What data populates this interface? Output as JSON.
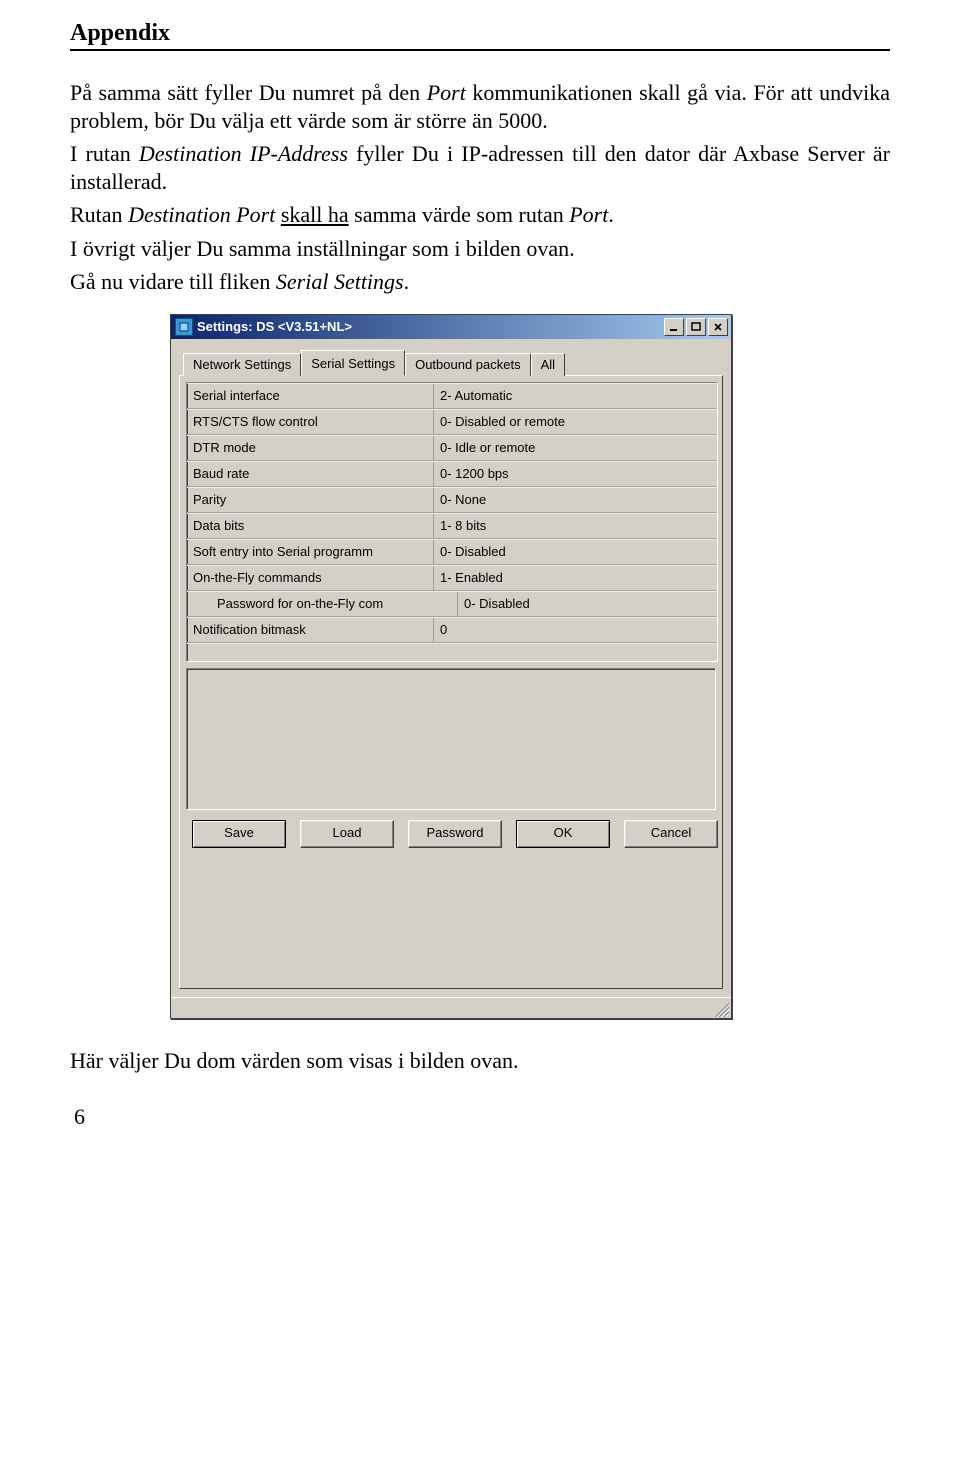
{
  "header": "Appendix",
  "paragraphs": {
    "p1_a": "På samma sätt fyller Du numret på den ",
    "p1_i": "Port",
    "p1_b": " kommunikationen skall gå via. För att undvika problem, bör Du välja ett värde som är större än 5000.",
    "p2_a": "I rutan ",
    "p2_i": "Destination IP-Address",
    "p2_b": " fyller Du i IP-adressen till den dator där Axbase Server är installerad.",
    "p3_a": "Rutan ",
    "p3_i": "Destination Port",
    "p3_b": " ",
    "p3_u": "skall ha",
    "p3_c": " samma värde som rutan ",
    "p3_i2": "Port",
    "p3_d": ".",
    "p4": "I övrigt väljer Du samma inställningar som i bilden ovan.",
    "p5_a": "Gå nu vidare till fliken ",
    "p5_i": "Serial Settings",
    "p5_b": ".",
    "p6": "Här väljer Du dom värden som visas i bilden ovan."
  },
  "page_number": "6",
  "window": {
    "title": "Settings: DS <V3.51+NL>",
    "tabs": [
      "Network Settings",
      "Serial Settings",
      "Outbound packets",
      "All"
    ],
    "active_tab": 1,
    "rows": [
      {
        "label": "Serial interface",
        "value": "2- Automatic"
      },
      {
        "label": "RTS/CTS flow control",
        "value": "0- Disabled or remote"
      },
      {
        "label": "DTR mode",
        "value": "0- Idle or remote"
      },
      {
        "label": "Baud rate",
        "value": "0- 1200 bps"
      },
      {
        "label": "Parity",
        "value": "0- None"
      },
      {
        "label": "Data bits",
        "value": "1- 8 bits"
      },
      {
        "label": "Soft entry into Serial programm",
        "value": "0- Disabled"
      },
      {
        "label": "On-the-Fly commands",
        "value": "1- Enabled"
      },
      {
        "label": "Password for on-the-Fly com",
        "value": "0- Disabled",
        "indent": true
      },
      {
        "label": "Notification bitmask",
        "value": "0"
      }
    ],
    "buttons": [
      "Save",
      "Load",
      "Password",
      "OK",
      "Cancel"
    ]
  }
}
